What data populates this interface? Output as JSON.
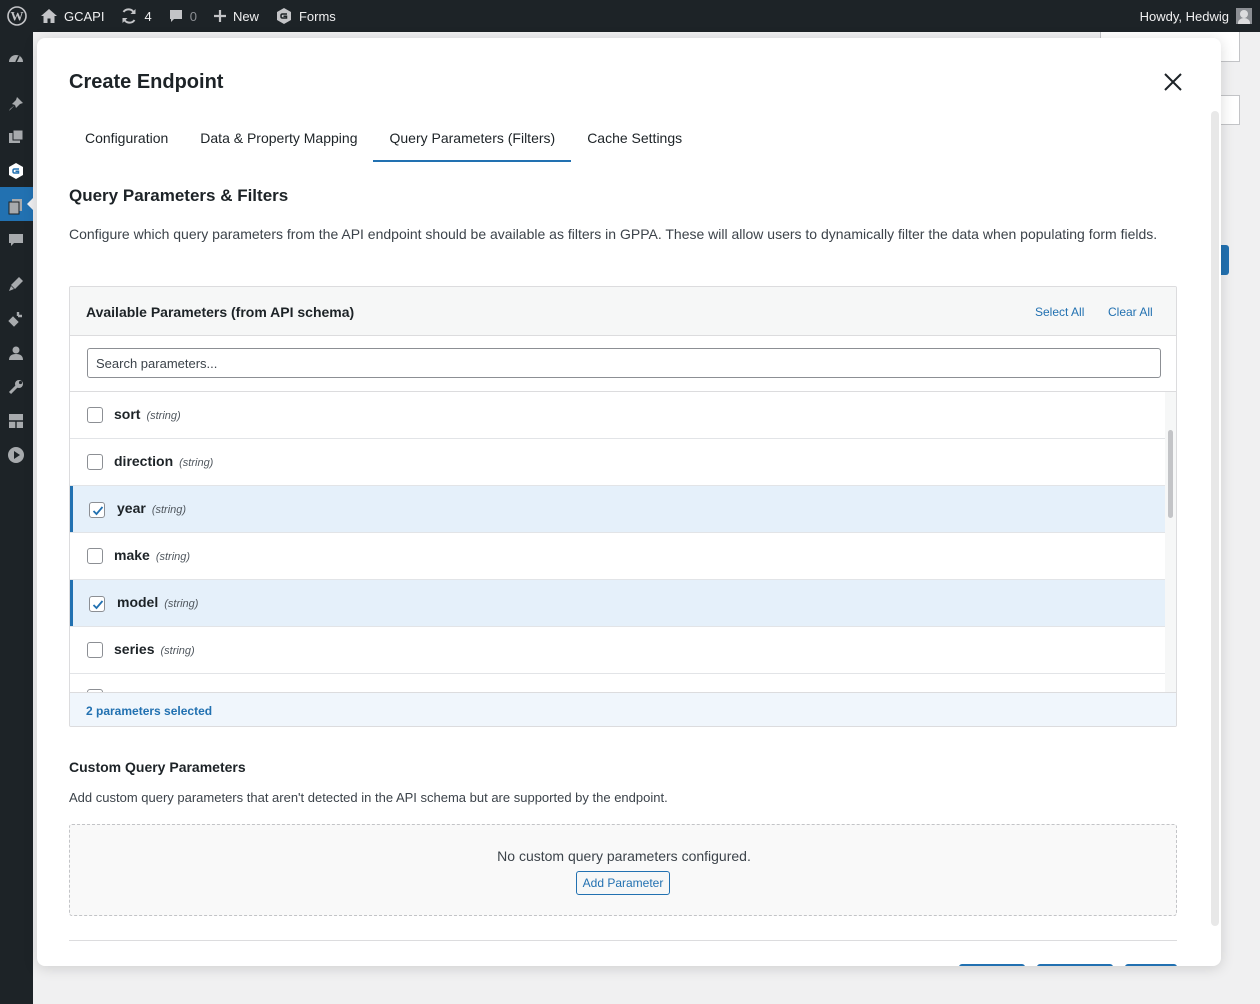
{
  "admin_bar": {
    "site_name": "GCAPI",
    "updates_count": "4",
    "comments_count": "0",
    "new_label": "New",
    "forms_label": "Forms",
    "howdy": "Howdy, Hedwig"
  },
  "modal": {
    "title": "Create Endpoint",
    "tabs": [
      {
        "label": "Configuration",
        "active": false
      },
      {
        "label": "Data & Property Mapping",
        "active": false
      },
      {
        "label": "Query Parameters (Filters)",
        "active": true
      },
      {
        "label": "Cache Settings",
        "active": false
      }
    ],
    "section_title": "Query Parameters & Filters",
    "section_desc": "Configure which query parameters from the API endpoint should be available as filters in GPPA. These will allow users to dynamically filter the data when populating form fields.",
    "available": {
      "title": "Available Parameters (from API schema)",
      "select_all": "Select All",
      "clear_all": "Clear All",
      "search_placeholder": "Search parameters...",
      "params": [
        {
          "name": "sort",
          "type": "(string)",
          "checked": false
        },
        {
          "name": "direction",
          "type": "(string)",
          "checked": false
        },
        {
          "name": "year",
          "type": "(string)",
          "checked": true
        },
        {
          "name": "make",
          "type": "(string)",
          "checked": false
        },
        {
          "name": "model",
          "type": "(string)",
          "checked": true
        },
        {
          "name": "series",
          "type": "(string)",
          "checked": false
        }
      ],
      "selected_count_label": "2 parameters selected"
    },
    "custom": {
      "title": "Custom Query Parameters",
      "desc": "Add custom query parameters that aren't detected in the API schema but are supported by the endpoint.",
      "empty_msg": "No custom query parameters configured.",
      "add_button": "Add Parameter"
    }
  },
  "colors": {
    "accent": "#2271b1",
    "admin_bar": "#1d2327",
    "selected_row": "#e5f0fa"
  }
}
